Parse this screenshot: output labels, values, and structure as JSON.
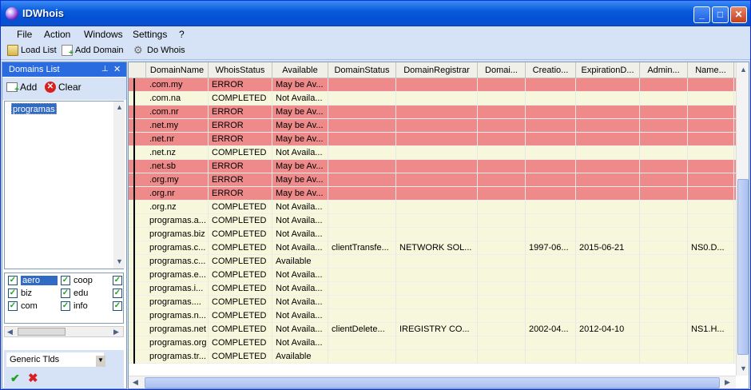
{
  "window": {
    "title": "IDWhois"
  },
  "menu": [
    "File",
    "Action",
    "Windows",
    "Settings",
    "?"
  ],
  "toolbar": {
    "load_list": "Load List",
    "add_domain": "Add Domain",
    "do_whois": "Do Whois"
  },
  "domains_panel": {
    "title": "Domains List",
    "add": "Add",
    "clear": "Clear",
    "items": [
      "programas"
    ],
    "tlds": [
      {
        "name": "aero",
        "checked": true,
        "selected": true
      },
      {
        "name": "coop",
        "checked": true
      },
      {
        "name": "biz",
        "checked": true
      },
      {
        "name": "edu",
        "checked": true
      },
      {
        "name": "com",
        "checked": true
      },
      {
        "name": "info",
        "checked": true
      }
    ],
    "tld_type": "Generic Tlds"
  },
  "columns": [
    "DomainName",
    "WhoisStatus",
    "Available",
    "DomainStatus",
    "DomainRegistrar",
    "Domai...",
    "Creatio...",
    "ExpirationD...",
    "Admin...",
    "Name..."
  ],
  "rows": [
    {
      "cells": [
        ".com.my",
        "ERROR",
        "May be Av...",
        "",
        "",
        "",
        "",
        "",
        "",
        ""
      ],
      "status": "error"
    },
    {
      "cells": [
        ".com.na",
        "COMPLETED",
        "Not Availa...",
        "",
        "",
        "",
        "",
        "",
        "",
        ""
      ],
      "status": "ok"
    },
    {
      "cells": [
        ".com.nr",
        "ERROR",
        "May be Av...",
        "",
        "",
        "",
        "",
        "",
        "",
        ""
      ],
      "status": "error"
    },
    {
      "cells": [
        ".net.my",
        "ERROR",
        "May be Av...",
        "",
        "",
        "",
        "",
        "",
        "",
        ""
      ],
      "status": "error"
    },
    {
      "cells": [
        ".net.nr",
        "ERROR",
        "May be Av...",
        "",
        "",
        "",
        "",
        "",
        "",
        ""
      ],
      "status": "error"
    },
    {
      "cells": [
        ".net.nz",
        "COMPLETED",
        "Not Availa...",
        "",
        "",
        "",
        "",
        "",
        "",
        ""
      ],
      "status": "ok"
    },
    {
      "cells": [
        ".net.sb",
        "ERROR",
        "May be Av...",
        "",
        "",
        "",
        "",
        "",
        "",
        ""
      ],
      "status": "error"
    },
    {
      "cells": [
        ".org.my",
        "ERROR",
        "May be Av...",
        "",
        "",
        "",
        "",
        "",
        "",
        ""
      ],
      "status": "error"
    },
    {
      "cells": [
        ".org.nr",
        "ERROR",
        "May be Av...",
        "",
        "",
        "",
        "",
        "",
        "",
        ""
      ],
      "status": "error"
    },
    {
      "cells": [
        ".org.nz",
        "COMPLETED",
        "Not Availa...",
        "",
        "",
        "",
        "",
        "",
        "",
        ""
      ],
      "status": "ok"
    },
    {
      "cells": [
        "programas.a...",
        "COMPLETED",
        "Not Availa...",
        "",
        "",
        "",
        "",
        "",
        "",
        ""
      ],
      "status": "ok"
    },
    {
      "cells": [
        "programas.biz",
        "COMPLETED",
        "Not Availa...",
        "",
        "",
        "",
        "",
        "",
        "",
        ""
      ],
      "status": "ok"
    },
    {
      "cells": [
        "programas.c...",
        "COMPLETED",
        "Not Availa...",
        "clientTransfe...",
        "NETWORK SOL...",
        "",
        "1997-06...",
        "2015-06-21",
        "",
        "NS0.D..."
      ],
      "status": "ok"
    },
    {
      "cells": [
        "programas.c...",
        "COMPLETED",
        "Available",
        "",
        "",
        "",
        "",
        "",
        "",
        ""
      ],
      "status": "ok"
    },
    {
      "cells": [
        "programas.e...",
        "COMPLETED",
        "Not Availa...",
        "",
        "",
        "",
        "",
        "",
        "",
        ""
      ],
      "status": "ok"
    },
    {
      "cells": [
        "programas.i...",
        "COMPLETED",
        "Not Availa...",
        "",
        "",
        "",
        "",
        "",
        "",
        ""
      ],
      "status": "ok"
    },
    {
      "cells": [
        "programas....",
        "COMPLETED",
        "Not Availa...",
        "",
        "",
        "",
        "",
        "",
        "",
        ""
      ],
      "status": "ok"
    },
    {
      "cells": [
        "programas.n...",
        "COMPLETED",
        "Not Availa...",
        "",
        "",
        "",
        "",
        "",
        "",
        ""
      ],
      "status": "ok"
    },
    {
      "cells": [
        "programas.net",
        "COMPLETED",
        "Not Availa...",
        "clientDelete...",
        "IREGISTRY CO...",
        "",
        "2002-04...",
        "2012-04-10",
        "",
        "NS1.H..."
      ],
      "status": "ok"
    },
    {
      "cells": [
        "programas.org",
        "COMPLETED",
        "Not Availa...",
        "",
        "",
        "",
        "",
        "",
        "",
        ""
      ],
      "status": "ok"
    },
    {
      "cells": [
        "programas.tr...",
        "COMPLETED",
        "Available",
        "",
        "",
        "",
        "",
        "",
        "",
        ""
      ],
      "status": "ok"
    }
  ],
  "colors": {
    "error": "#ee8a8a",
    "ok": "#f7f7dc"
  }
}
